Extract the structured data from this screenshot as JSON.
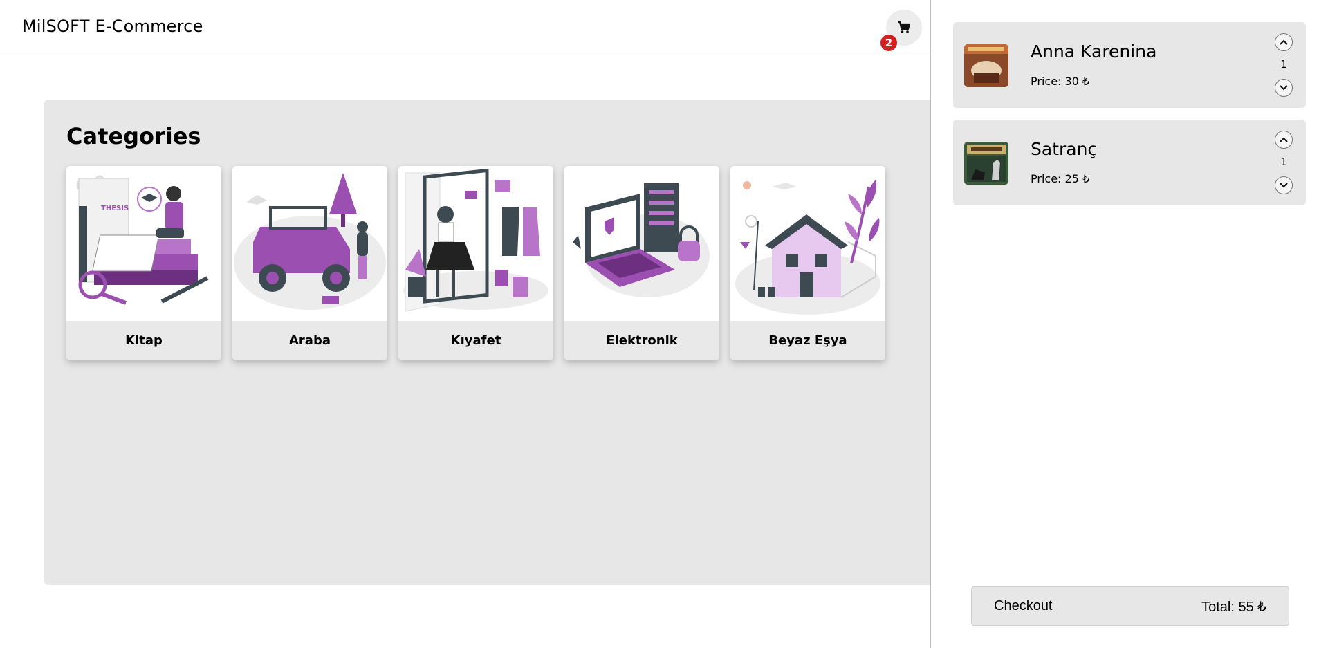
{
  "header": {
    "brand": "MilSOFT E-Commerce",
    "cart_icon": "cart-icon",
    "cart_count": "2"
  },
  "main": {
    "title": "Categories",
    "categories": [
      {
        "label": "Kitap",
        "illustration": "books-illustration"
      },
      {
        "label": "Araba",
        "illustration": "jeep-illustration"
      },
      {
        "label": "Kıyafet",
        "illustration": "clothing-illustration"
      },
      {
        "label": "Elektronik",
        "illustration": "laptop-illustration"
      },
      {
        "label": "Beyaz Eşya",
        "illustration": "house-illustration"
      }
    ]
  },
  "cart": {
    "items": [
      {
        "name": "Anna Karenina",
        "price": "Price: 30 ₺",
        "quantity": "1"
      },
      {
        "name": "Satranç",
        "price": "Price: 25 ₺",
        "quantity": "1"
      }
    ],
    "checkout_label": "Checkout",
    "total": "Total: 55 ₺"
  },
  "colors": {
    "accent": "#9b4fb0",
    "badge": "#d42020",
    "panel": "#e7e7e8"
  }
}
